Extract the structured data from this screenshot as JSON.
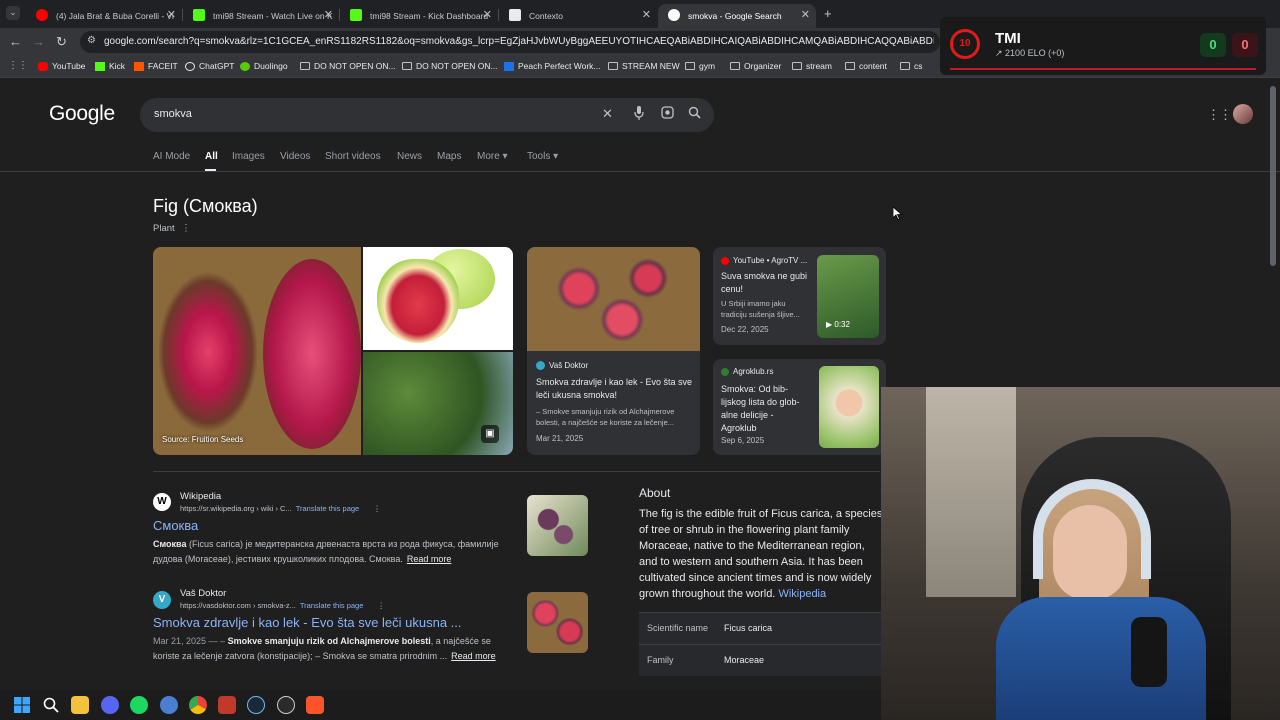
{
  "tabs": [
    {
      "label": "(4) Jala Brat & Buba Corelli - Vi",
      "color": "#ff0000"
    },
    {
      "label": "tmi98 Stream - Watch Live on K",
      "color": "#53fc18"
    },
    {
      "label": "tmi98 Stream - Kick Dashboard",
      "color": "#53fc18"
    },
    {
      "label": "Contexto",
      "color": "#e8eaed"
    },
    {
      "label": "smokva - Google Search",
      "color": "#4285f4"
    }
  ],
  "address_bar": {
    "url": "google.com/search?q=smokva&rlz=1C1GCEA_enRS1182RS1182&oq=smokva&gs_lcrp=EgZjaHJvbWUyBggAEEUYOTIHCAEQABiABDIHCAIQABiABDIHCAMQABiABDIHCAQQABiABDIHCAUQABiABDIHCAY"
  },
  "bookmarks": [
    {
      "label": "YouTube",
      "icon": "youtube-icon"
    },
    {
      "label": "Kick",
      "icon": "kick-icon"
    },
    {
      "label": "FACEIT",
      "icon": "faceit-icon"
    },
    {
      "label": "ChatGPT",
      "icon": "chatgpt-icon"
    },
    {
      "label": "Duolingo",
      "icon": "duolingo-icon"
    },
    {
      "label": "DO NOT OPEN ON...",
      "icon": "folder-icon"
    },
    {
      "label": "DO NOT OPEN ON...",
      "icon": "folder-icon"
    },
    {
      "label": "Peach Perfect Work...",
      "icon": "peach-icon"
    },
    {
      "label": "STREAM NEW",
      "icon": "folder-icon"
    },
    {
      "label": "gym",
      "icon": "folder-icon"
    },
    {
      "label": "Organizer",
      "icon": "folder-icon"
    },
    {
      "label": "stream",
      "icon": "folder-icon"
    },
    {
      "label": "content",
      "icon": "folder-icon"
    },
    {
      "label": "cs",
      "icon": "folder-icon"
    }
  ],
  "google": {
    "logo": "Google",
    "query": "smokva",
    "filters": [
      "AI Mode",
      "All",
      "Images",
      "Videos",
      "Short videos",
      "News",
      "Maps",
      "More ▾",
      "Tools ▾"
    ]
  },
  "knowledge_panel": {
    "title": "Fig (Смоква)",
    "subtitle": "Plant",
    "image_source": "Source: Fruition Seeds",
    "cards": [
      {
        "source": "Vaš Doktor",
        "title": "Smokva zdravlje i kao lek - Evo šta sve leči ukusna smokva!",
        "snippet": "– Smokve smanjuju rizik od Alchajmerove bolesti, a najčešće se koriste za lečenje...",
        "date": "Mar 21, 2025"
      },
      {
        "source": "YouTube • AgroTV ...",
        "title": "Suva smokva ne gubi cenu!",
        "snippet": "U Srbiji imamo jaku tradiciju sušenja šljive...",
        "date": "Dec 22, 2025",
        "duration": "0:32"
      },
      {
        "source": "Agroklub.rs",
        "title": "Smokva: Od bib-lijskog lista do glob-alne delicije - Agroklub",
        "date": "Sep 6, 2025"
      }
    ],
    "about": {
      "heading": "About",
      "text": "The fig is the edible fruit of Ficus carica, a species of tree or shrub in the flowering plant family Moraceae, native to the Mediterranean region, and to western and southern Asia. It has been cultivated since ancient times and is now widely grown throughout the world.",
      "link": "Wikipedia",
      "facts": [
        {
          "key": "Scientific name",
          "value": "Ficus carica"
        },
        {
          "key": "Family",
          "value": "Moraceae"
        }
      ]
    }
  },
  "results": [
    {
      "site": "Wikipedia",
      "url": "https://sr.wikipedia.org › wiki › C...",
      "translate": "Translate this page",
      "title": "Смоква",
      "snippet_bold": "Смоква",
      "snippet": " (Ficus carica) је медитеранска дрвенаста врста из рода фикуса, фамилије дудова (Moraceae), јестивих крушколиких плодова. Смоква.",
      "read_more": "Read more"
    },
    {
      "site": "Vaš Doktor",
      "url": "https://vasdoktor.com › smokva-z...",
      "translate": "Translate this page",
      "title": "Smokva zdravlje i kao lek - Evo šta sve leči ukusna ...",
      "date": "Mar 21, 2025 — –",
      "snippet_bold": "Smokve smanjuju rizik od Alchajmerove bolesti",
      "snippet": ", a najčešće se koriste za lečenje zatvora (konstipacije); – Smokva se smatra prirodnim ...",
      "read_more": "Read more"
    }
  ],
  "overlay": {
    "name": "TMI",
    "level": "10",
    "elo": "2100 ELO (+0)",
    "wins": "0",
    "losses": "0"
  }
}
